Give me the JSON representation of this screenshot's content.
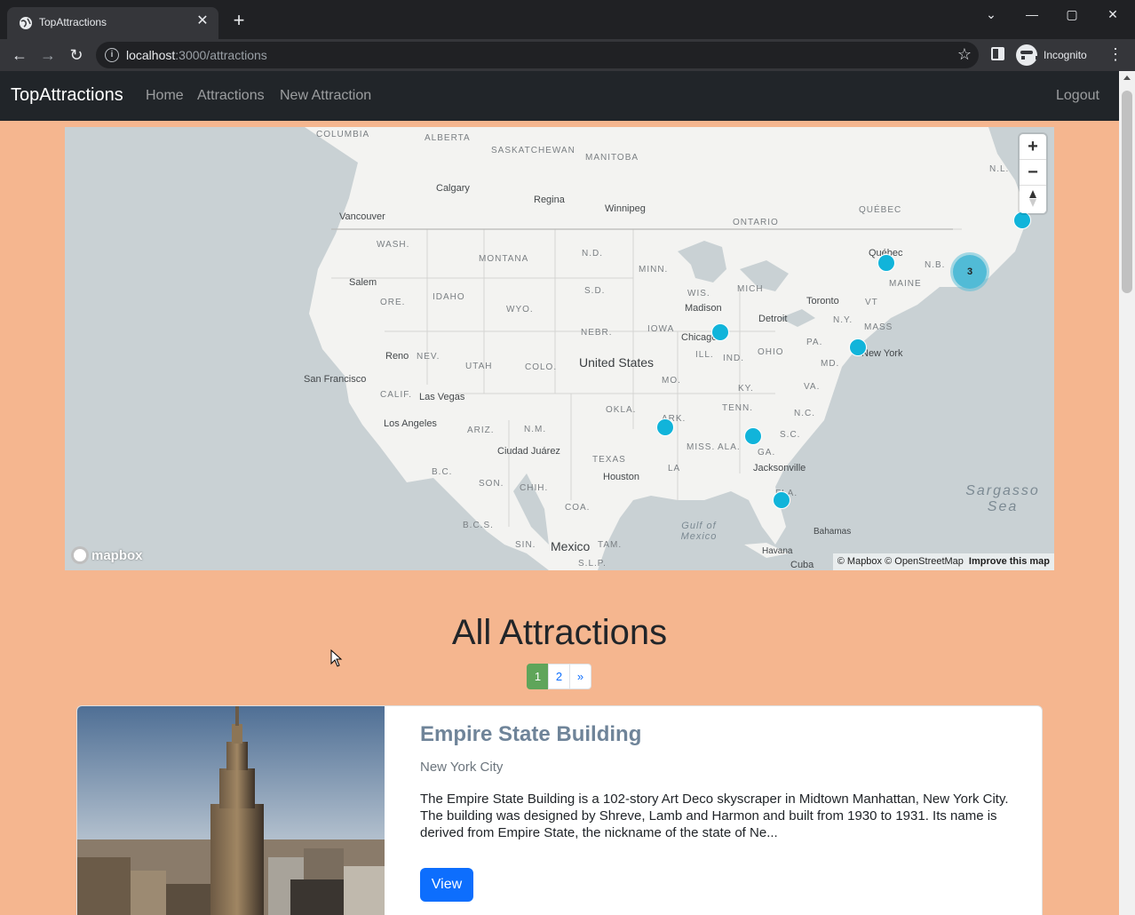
{
  "browser": {
    "tab_title": "TopAttractions",
    "url_host": "localhost",
    "url_rest": ":3000/attractions",
    "profile_label": "Incognito"
  },
  "navbar": {
    "brand": "TopAttractions",
    "links": [
      "Home",
      "Attractions",
      "New Attraction"
    ],
    "logout": "Logout"
  },
  "map": {
    "labels": {
      "columbia": "COLUMBIA",
      "alberta": "ALBERTA",
      "saskatchewan": "SASKATCHEWAN",
      "manitoba": "MANITOBA",
      "nl": "N.L.",
      "calgary": "Calgary",
      "regina": "Regina",
      "winnipeg": "Winnipeg",
      "vancouver": "Vancouver",
      "ontario": "ONTARIO",
      "quebec_region": "QUÉBEC",
      "wash": "WASH.",
      "nd": "N.D.",
      "montana": "MONTANA",
      "minn": "MINN.",
      "quebec_city": "Québec",
      "nb": "N.B.",
      "salem": "Salem",
      "idaho": "IDAHO",
      "sd": "S.D.",
      "wis": "WIS.",
      "mich": "MICH",
      "maine": "MAINE",
      "toronto": "Toronto",
      "vt": "VT",
      "ore": "ORE.",
      "wyo": "WYO.",
      "madison": "Madison",
      "detroit": "Detroit",
      "ny": "N.Y.",
      "iowa": "IOWA",
      "nebr": "NEBR.",
      "mass": "MASS",
      "chicago": "Chicago",
      "pa": "PA.",
      "ohio": "OHIO",
      "reno": "Reno",
      "nev": "NEV.",
      "utah": "UTAH",
      "colo": "COLO.",
      "united_states": "United States",
      "ill": "ILL.",
      "ind": "IND.",
      "md": "MD.",
      "new_york": "New York",
      "san_francisco": "San Francisco",
      "mo": "MO.",
      "va": "VA.",
      "calif": "CALIF.",
      "las_vegas": "Las Vegas",
      "ky": "KY.",
      "okla": "OKLA.",
      "tenn": "TENN.",
      "nc": "N.C.",
      "los_angeles": "Los Angeles",
      "ariz": "ARIZ.",
      "nm": "N.M.",
      "ark": "ARK.",
      "sc": "S.C.",
      "ciudad_juarez": "Ciudad Juárez",
      "miss": "MISS.",
      "ala": "ALA.",
      "ga": "GA.",
      "texas": "TEXAS",
      "la": "LA",
      "jacksonville": "Jacksonville",
      "bc": "B.C.",
      "son": "SON.",
      "chih": "CHIH.",
      "houston": "Houston",
      "sargasso_sea": "Sargasso Sea",
      "coa": "COA.",
      "fla": "FLA.",
      "bcs": "B.C.S.",
      "gulf_of_mexico": "Gulf of Mexico",
      "bahamas": "Bahamas",
      "sin": "SIN.",
      "mexico": "Mexico",
      "tam": "TAM.",
      "slp": "S.L.P.",
      "havana": "Havana",
      "cuba": "Cuba"
    },
    "cluster_count": "3",
    "mapbox_logo": "mapbox",
    "attribution": "© Mapbox © OpenStreetMap",
    "improve": "Improve this map"
  },
  "page": {
    "heading": "All Attractions",
    "pagination": [
      "1",
      "2",
      "»"
    ],
    "current_page": "1"
  },
  "attractions": [
    {
      "title": "Empire State Building",
      "location": "New York City",
      "description": "The Empire State Building is a 102-story Art Deco skyscraper in Midtown Manhattan, New York City. The building was designed by Shreve, Lamb and Harmon and built from 1930 to 1931. Its name is derived from Empire State, the nickname of the state of Ne...",
      "button": "View"
    }
  ]
}
